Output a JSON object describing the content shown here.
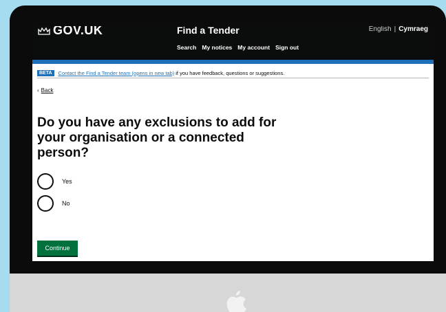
{
  "header": {
    "logo_text": "GOV.UK",
    "service_name": "Find a Tender",
    "lang_english": "English",
    "lang_separator": "|",
    "lang_welsh": "Cymraeg",
    "nav": [
      "Search",
      "My notices",
      "My account",
      "Sign out"
    ]
  },
  "beta_banner": {
    "tag": "BETA",
    "link_text": "Contact the Find a Tender team (opens in new tab)",
    "rest_text": "if you have feedback, questions or suggestions."
  },
  "back_link": "Back",
  "question": "Do you have any exclusions to add for your organisation or a connected person?",
  "options": [
    "Yes",
    "No"
  ],
  "continue_label": "Continue",
  "colors": {
    "background": "#a6dcef",
    "header": "#0b0c0c",
    "link": "#1d70b8",
    "button": "#00703c"
  },
  "icons": [
    "crown-icon",
    "back-chevron-icon",
    "apple-logo-icon"
  ]
}
